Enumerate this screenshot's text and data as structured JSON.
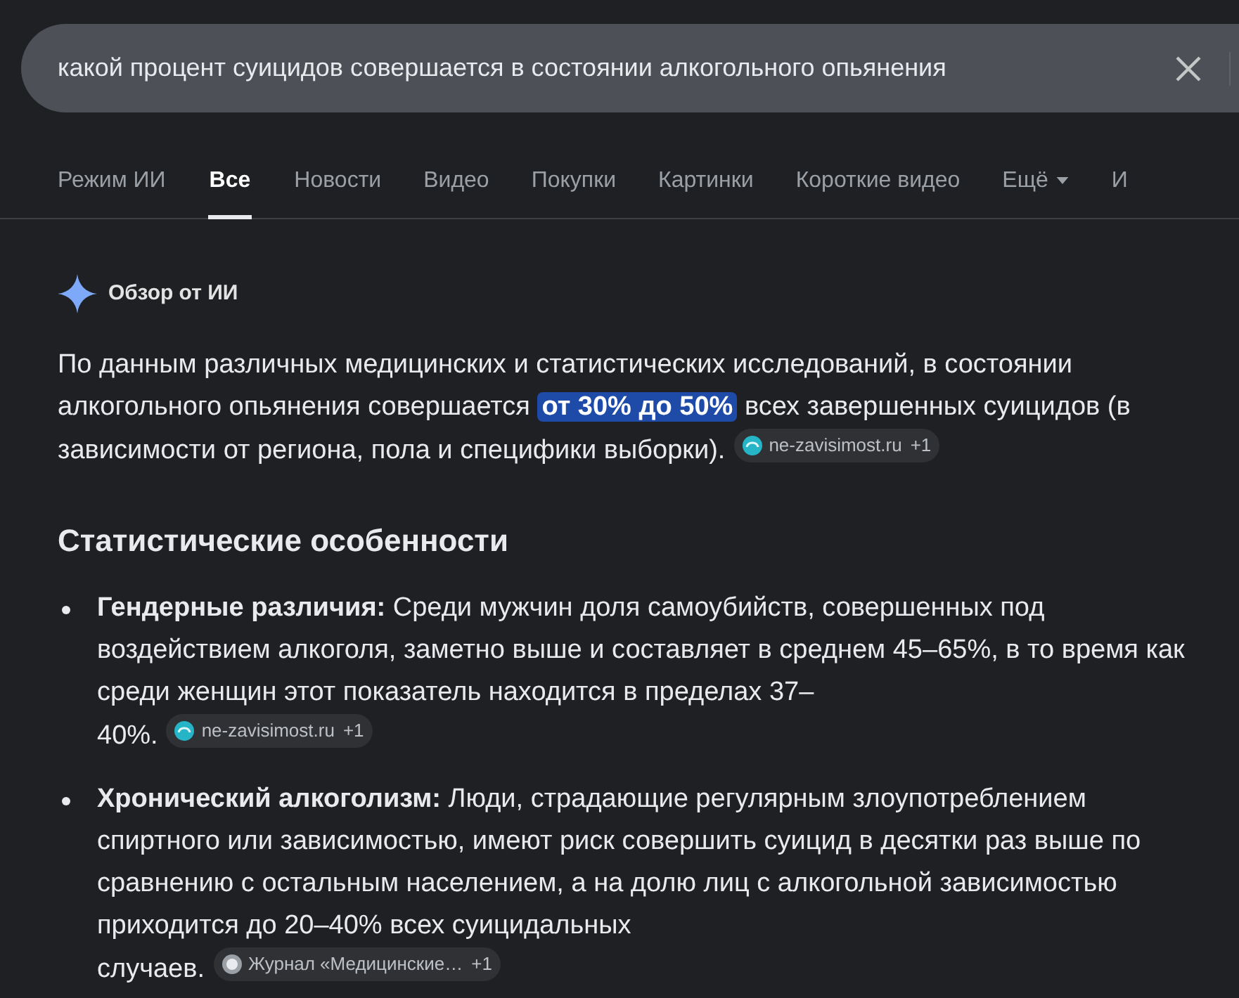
{
  "search": {
    "value": "какой процент суицидов совершается в состоянии алкогольного опьянения"
  },
  "tabs": [
    {
      "label": "Режим ИИ",
      "selected": false
    },
    {
      "label": "Все",
      "selected": true
    },
    {
      "label": "Новости",
      "selected": false
    },
    {
      "label": "Видео",
      "selected": false
    },
    {
      "label": "Покупки",
      "selected": false
    },
    {
      "label": "Картинки",
      "selected": false
    },
    {
      "label": "Короткие видео",
      "selected": false
    },
    {
      "label": "Ещё",
      "selected": false,
      "kind": "menu"
    },
    {
      "label": "И",
      "selected": false
    }
  ],
  "overview": {
    "title": "Обзор от ИИ",
    "intro": {
      "before": "По данным различных медицинских и статистических исследований, в состоянии алкогольного опьянения совершается ",
      "highlight": "от 30% до 50%",
      "after": " всех завершенных суицидов (в зависимости от региона, пола и специфики выборки).",
      "source": {
        "label": "ne-zavisimost.ru",
        "count": "+1",
        "kind": "site"
      }
    },
    "heading": "Статистические особенности",
    "bullets": [
      {
        "lines": [
          "**Гендерные различия:** Среди мужчин доля самоубийств, совершенных под воздействием алкоголя, заметно выше и составляет в среднем 45–65%, в то время как среди женщин этот показатель находится в пределах 37–",
          "40%."
        ],
        "source": {
          "label": "ne-zavisimost.ru",
          "count": "+1",
          "kind": "site"
        }
      },
      {
        "lines": [
          "**Хронический алкоголизм:** Люди, страдающие регулярным злоупотреблением спиртного или зависимостью, имеют риск совершить суицид в десятки раз выше по сравнению с остальным населением, а на долю лиц с алкогольной зависимостью приходится до 20–40% всех суицидальных",
          "случаев."
        ],
        "source": {
          "label": "Журнал «Медицинские…",
          "count": "+1",
          "kind": "journal"
        }
      }
    ]
  }
}
